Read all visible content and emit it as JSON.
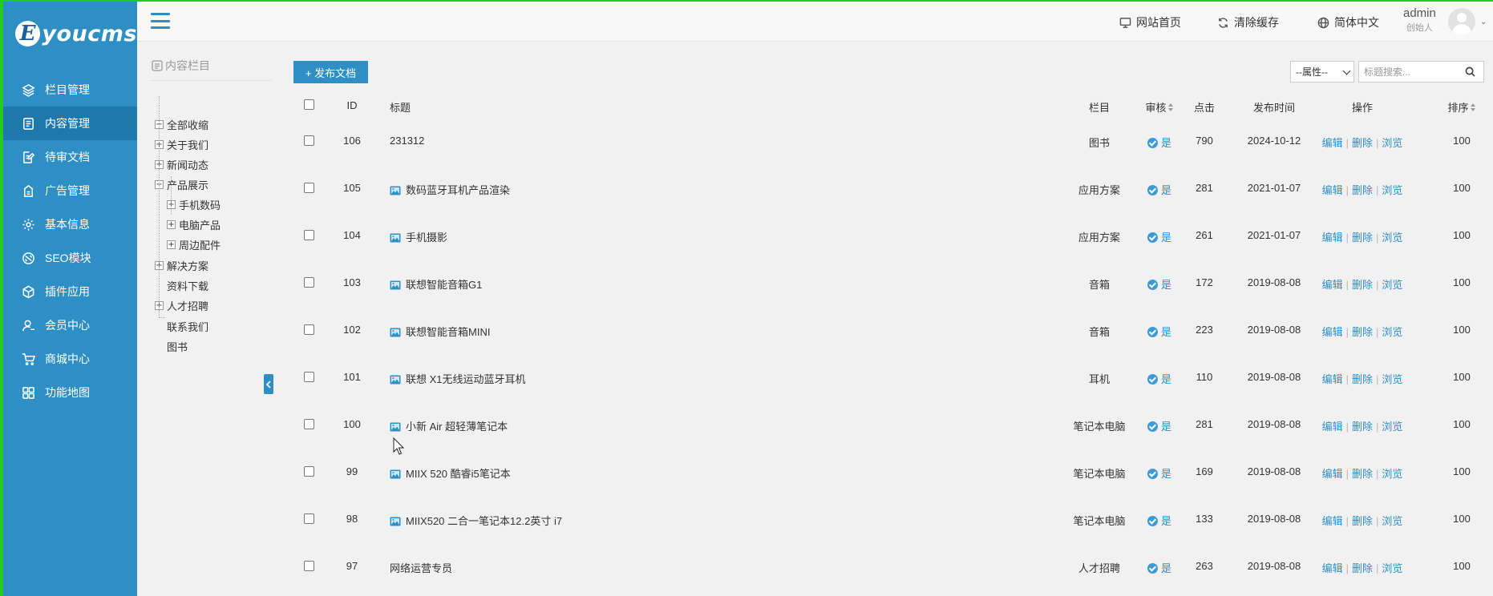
{
  "logo": {
    "letter": "E",
    "text": "youcms"
  },
  "sidebar": {
    "items": [
      {
        "label": "栏目管理",
        "icon": "layers-icon",
        "active": false
      },
      {
        "label": "内容管理",
        "icon": "document-icon",
        "active": true
      },
      {
        "label": "待审文档",
        "icon": "edit-doc-icon",
        "active": false
      },
      {
        "label": "广告管理",
        "icon": "ad-icon",
        "active": false
      },
      {
        "label": "基本信息",
        "icon": "gear-icon",
        "active": false
      },
      {
        "label": "SEO模块",
        "icon": "seo-icon",
        "active": false
      },
      {
        "label": "插件应用",
        "icon": "cube-icon",
        "active": false
      },
      {
        "label": "会员中心",
        "icon": "user-icon",
        "active": false
      },
      {
        "label": "商城中心",
        "icon": "cart-icon",
        "active": false
      },
      {
        "label": "功能地图",
        "icon": "grid-icon",
        "active": false
      }
    ]
  },
  "header": {
    "links": [
      {
        "label": "网站首页",
        "icon": "monitor-icon"
      },
      {
        "label": "清除缓存",
        "icon": "refresh-icon"
      },
      {
        "label": "简体中文",
        "icon": "globe-icon"
      }
    ],
    "user": {
      "name": "admin",
      "role": "创始人"
    }
  },
  "tree": {
    "title": "内容栏目",
    "items": [
      {
        "label": "全部收缩",
        "toggle": "-",
        "level": 0
      },
      {
        "label": "关于我们",
        "toggle": "+",
        "level": 0
      },
      {
        "label": "新闻动态",
        "toggle": "+",
        "level": 0
      },
      {
        "label": "产品展示",
        "toggle": "-",
        "level": 0
      },
      {
        "label": "手机数码",
        "toggle": "+",
        "level": 1
      },
      {
        "label": "电脑产品",
        "toggle": "+",
        "level": 1
      },
      {
        "label": "周边配件",
        "toggle": "+",
        "level": 1
      },
      {
        "label": "解决方案",
        "toggle": "+",
        "level": 0
      },
      {
        "label": "资料下载",
        "toggle": "",
        "level": 0
      },
      {
        "label": "人才招聘",
        "toggle": "+",
        "level": 0
      },
      {
        "label": "联系我们",
        "toggle": "",
        "level": 0
      },
      {
        "label": "图书",
        "toggle": "",
        "level": 0
      }
    ]
  },
  "toolbar": {
    "publish_label": "+ 发布文档",
    "attr_select": "--属性--",
    "search_placeholder": "标题搜索..."
  },
  "table": {
    "headers": {
      "id": "ID",
      "title": "标题",
      "column": "栏目",
      "audit": "审核",
      "clicks": "点击",
      "date": "发布时间",
      "ops": "操作",
      "sort": "排序"
    },
    "op_labels": {
      "edit": "编辑",
      "delete": "删除",
      "view": "浏览"
    },
    "rows": [
      {
        "id": "106",
        "title": "231312",
        "has_image": false,
        "column": "图书",
        "audit": "是",
        "clicks": "790",
        "date": "2024-10-12",
        "sort": "100"
      },
      {
        "id": "105",
        "title": "数码蓝牙耳机产品渲染",
        "has_image": true,
        "column": "应用方案",
        "audit": "是",
        "clicks": "281",
        "date": "2021-01-07",
        "sort": "100"
      },
      {
        "id": "104",
        "title": "手机摄影",
        "has_image": true,
        "column": "应用方案",
        "audit": "是",
        "clicks": "261",
        "date": "2021-01-07",
        "sort": "100"
      },
      {
        "id": "103",
        "title": "联想智能音箱G1",
        "has_image": true,
        "column": "音箱",
        "audit": "是",
        "clicks": "172",
        "date": "2019-08-08",
        "sort": "100"
      },
      {
        "id": "102",
        "title": "联想智能音箱MINI",
        "has_image": true,
        "column": "音箱",
        "audit": "是",
        "clicks": "223",
        "date": "2019-08-08",
        "sort": "100"
      },
      {
        "id": "101",
        "title": "联想 X1无线运动蓝牙耳机",
        "has_image": true,
        "column": "耳机",
        "audit": "是",
        "clicks": "110",
        "date": "2019-08-08",
        "sort": "100"
      },
      {
        "id": "100",
        "title": "小新 Air 超轻薄笔记本",
        "has_image": true,
        "column": "笔记本电脑",
        "audit": "是",
        "clicks": "281",
        "date": "2019-08-08",
        "sort": "100"
      },
      {
        "id": "99",
        "title": "MIIX 520 酷睿i5笔记本",
        "has_image": true,
        "column": "笔记本电脑",
        "audit": "是",
        "clicks": "169",
        "date": "2019-08-08",
        "sort": "100"
      },
      {
        "id": "98",
        "title": "MIIX520 二合一笔记本12.2英寸 i7",
        "has_image": true,
        "column": "笔记本电脑",
        "audit": "是",
        "clicks": "133",
        "date": "2019-08-08",
        "sort": "100"
      },
      {
        "id": "97",
        "title": "网络运营专员",
        "has_image": false,
        "column": "人才招聘",
        "audit": "是",
        "clicks": "263",
        "date": "2019-08-08",
        "sort": "100"
      }
    ]
  },
  "colors": {
    "accent": "#2e8fc5",
    "sidebar_active": "#1f78ac",
    "frame": "#22cc22"
  }
}
